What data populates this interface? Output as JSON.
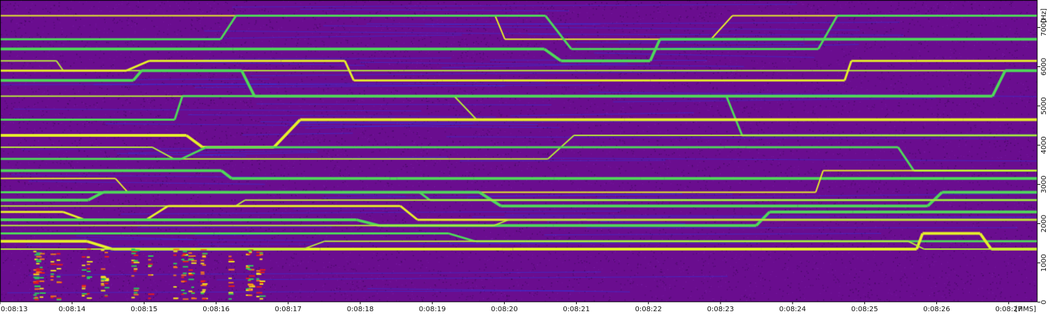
{
  "chart_data": {
    "type": "heatmap",
    "kind": "spectrogram",
    "title": "",
    "x_axis": {
      "unit_label": "[HMS]",
      "ticks": [
        "0:08:13",
        "0:08:14",
        "0:08:15",
        "0:08:16",
        "0:08:17",
        "0:08:18",
        "0:08:19",
        "0:08:20",
        "0:08:21",
        "0:08:22",
        "0:08:23",
        "0:08:24",
        "0:08:25",
        "0:08:26",
        "0:08:27"
      ],
      "range_seconds": [
        493,
        507.4
      ]
    },
    "y_axis": {
      "unit_label": "[Hz]",
      "ticks": [
        0,
        1000,
        2000,
        3000,
        4000,
        5000,
        6000,
        7000
      ],
      "range": [
        0,
        7700
      ],
      "position": "right"
    },
    "colormap": [
      "#000000",
      "#6a0d8f",
      "#2c2ce8",
      "#1e8fd6",
      "#2ccf5a",
      "#c8f03c",
      "#f2e81c",
      "#f07a1c",
      "#e81c1c"
    ],
    "background_color": "#6a0d8f",
    "steady_tones_hz": [
      7300,
      6700,
      6450,
      6150,
      5900,
      5650,
      5250,
      4650,
      4250,
      3950,
      3650,
      3350,
      3150,
      2800,
      2600,
      2450,
      2300,
      2100,
      1950,
      1750,
      1550,
      1350
    ]
  }
}
